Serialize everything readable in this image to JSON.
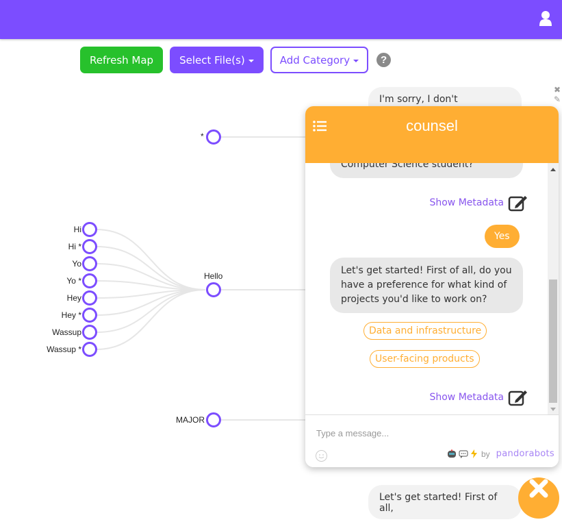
{
  "topbar": {
    "color": "#7c4dff",
    "user_icon": "user-icon"
  },
  "toolbar": {
    "refresh_label": "Refresh Map",
    "select_files_label": "Select File(s)",
    "add_category_label": "Add Category",
    "help_glyph": "?"
  },
  "map": {
    "nodes": {
      "star": "*",
      "hello": "Hello",
      "major": "MAJOR",
      "inputs": [
        "Hi",
        "Hi *",
        "Yo",
        "Yo *",
        "Hey",
        "Hey *",
        "Wassup",
        "Wassup *"
      ]
    },
    "bg_bubbles": {
      "top": "I'm sorry, I don't",
      "bottom": "Let's get started! First of all,"
    }
  },
  "chat": {
    "title": "counsel",
    "header_color": "#ffae33",
    "partial_bot_message": "Computer Science student?",
    "metadata_label": "Show Metadata",
    "user_message": "Yes",
    "bot_message": "Let's get started! First of all, do you have a preference for what kind of projects you'd like to work on?",
    "quick_replies": [
      "Data and infrastructure",
      "User-facing products"
    ],
    "input_placeholder": "Type a message...",
    "powered_by": "by",
    "brand": "pandorabots"
  }
}
